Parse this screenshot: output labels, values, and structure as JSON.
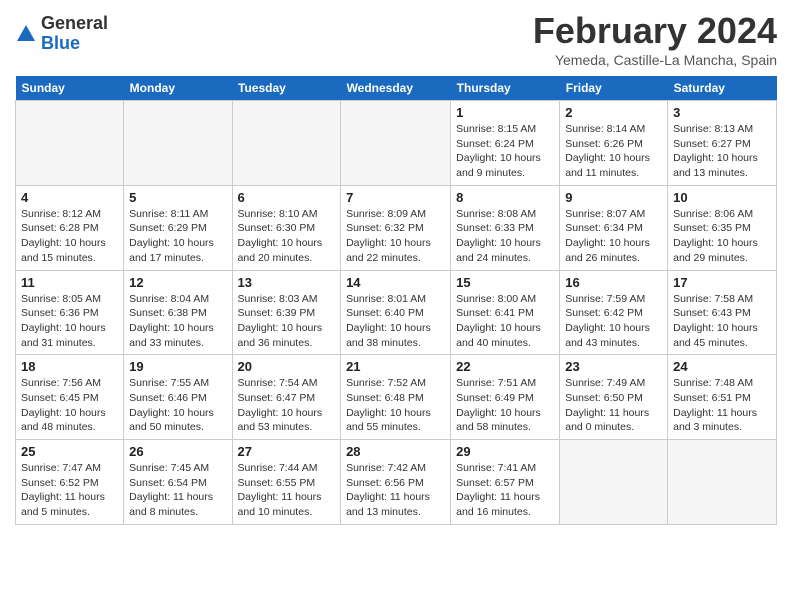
{
  "logo": {
    "general": "General",
    "blue": "Blue"
  },
  "header": {
    "title": "February 2024",
    "location": "Yemeda, Castille-La Mancha, Spain"
  },
  "weekdays": [
    "Sunday",
    "Monday",
    "Tuesday",
    "Wednesday",
    "Thursday",
    "Friday",
    "Saturday"
  ],
  "weeks": [
    [
      {
        "day": "",
        "info": ""
      },
      {
        "day": "",
        "info": ""
      },
      {
        "day": "",
        "info": ""
      },
      {
        "day": "",
        "info": ""
      },
      {
        "day": "1",
        "info": "Sunrise: 8:15 AM\nSunset: 6:24 PM\nDaylight: 10 hours\nand 9 minutes."
      },
      {
        "day": "2",
        "info": "Sunrise: 8:14 AM\nSunset: 6:26 PM\nDaylight: 10 hours\nand 11 minutes."
      },
      {
        "day": "3",
        "info": "Sunrise: 8:13 AM\nSunset: 6:27 PM\nDaylight: 10 hours\nand 13 minutes."
      }
    ],
    [
      {
        "day": "4",
        "info": "Sunrise: 8:12 AM\nSunset: 6:28 PM\nDaylight: 10 hours\nand 15 minutes."
      },
      {
        "day": "5",
        "info": "Sunrise: 8:11 AM\nSunset: 6:29 PM\nDaylight: 10 hours\nand 17 minutes."
      },
      {
        "day": "6",
        "info": "Sunrise: 8:10 AM\nSunset: 6:30 PM\nDaylight: 10 hours\nand 20 minutes."
      },
      {
        "day": "7",
        "info": "Sunrise: 8:09 AM\nSunset: 6:32 PM\nDaylight: 10 hours\nand 22 minutes."
      },
      {
        "day": "8",
        "info": "Sunrise: 8:08 AM\nSunset: 6:33 PM\nDaylight: 10 hours\nand 24 minutes."
      },
      {
        "day": "9",
        "info": "Sunrise: 8:07 AM\nSunset: 6:34 PM\nDaylight: 10 hours\nand 26 minutes."
      },
      {
        "day": "10",
        "info": "Sunrise: 8:06 AM\nSunset: 6:35 PM\nDaylight: 10 hours\nand 29 minutes."
      }
    ],
    [
      {
        "day": "11",
        "info": "Sunrise: 8:05 AM\nSunset: 6:36 PM\nDaylight: 10 hours\nand 31 minutes."
      },
      {
        "day": "12",
        "info": "Sunrise: 8:04 AM\nSunset: 6:38 PM\nDaylight: 10 hours\nand 33 minutes."
      },
      {
        "day": "13",
        "info": "Sunrise: 8:03 AM\nSunset: 6:39 PM\nDaylight: 10 hours\nand 36 minutes."
      },
      {
        "day": "14",
        "info": "Sunrise: 8:01 AM\nSunset: 6:40 PM\nDaylight: 10 hours\nand 38 minutes."
      },
      {
        "day": "15",
        "info": "Sunrise: 8:00 AM\nSunset: 6:41 PM\nDaylight: 10 hours\nand 40 minutes."
      },
      {
        "day": "16",
        "info": "Sunrise: 7:59 AM\nSunset: 6:42 PM\nDaylight: 10 hours\nand 43 minutes."
      },
      {
        "day": "17",
        "info": "Sunrise: 7:58 AM\nSunset: 6:43 PM\nDaylight: 10 hours\nand 45 minutes."
      }
    ],
    [
      {
        "day": "18",
        "info": "Sunrise: 7:56 AM\nSunset: 6:45 PM\nDaylight: 10 hours\nand 48 minutes."
      },
      {
        "day": "19",
        "info": "Sunrise: 7:55 AM\nSunset: 6:46 PM\nDaylight: 10 hours\nand 50 minutes."
      },
      {
        "day": "20",
        "info": "Sunrise: 7:54 AM\nSunset: 6:47 PM\nDaylight: 10 hours\nand 53 minutes."
      },
      {
        "day": "21",
        "info": "Sunrise: 7:52 AM\nSunset: 6:48 PM\nDaylight: 10 hours\nand 55 minutes."
      },
      {
        "day": "22",
        "info": "Sunrise: 7:51 AM\nSunset: 6:49 PM\nDaylight: 10 hours\nand 58 minutes."
      },
      {
        "day": "23",
        "info": "Sunrise: 7:49 AM\nSunset: 6:50 PM\nDaylight: 11 hours\nand 0 minutes."
      },
      {
        "day": "24",
        "info": "Sunrise: 7:48 AM\nSunset: 6:51 PM\nDaylight: 11 hours\nand 3 minutes."
      }
    ],
    [
      {
        "day": "25",
        "info": "Sunrise: 7:47 AM\nSunset: 6:52 PM\nDaylight: 11 hours\nand 5 minutes."
      },
      {
        "day": "26",
        "info": "Sunrise: 7:45 AM\nSunset: 6:54 PM\nDaylight: 11 hours\nand 8 minutes."
      },
      {
        "day": "27",
        "info": "Sunrise: 7:44 AM\nSunset: 6:55 PM\nDaylight: 11 hours\nand 10 minutes."
      },
      {
        "day": "28",
        "info": "Sunrise: 7:42 AM\nSunset: 6:56 PM\nDaylight: 11 hours\nand 13 minutes."
      },
      {
        "day": "29",
        "info": "Sunrise: 7:41 AM\nSunset: 6:57 PM\nDaylight: 11 hours\nand 16 minutes."
      },
      {
        "day": "",
        "info": ""
      },
      {
        "day": "",
        "info": ""
      }
    ]
  ]
}
